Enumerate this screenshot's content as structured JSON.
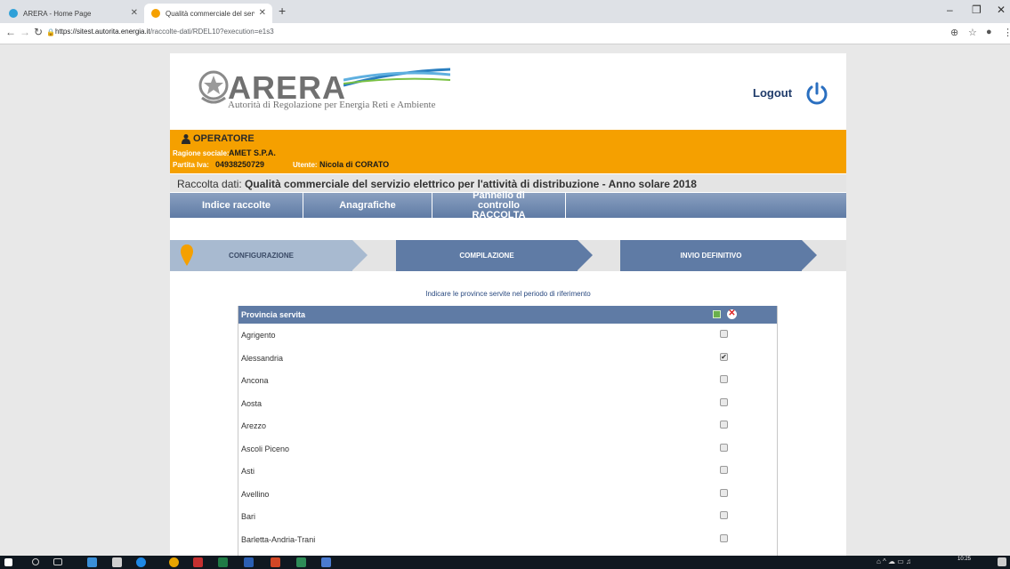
{
  "browser": {
    "tabs": [
      {
        "title": "ARERA - Home Page"
      },
      {
        "title": "Qualità commerciale del servizio"
      }
    ],
    "url_host": "https://sitest.autorita.energia.it",
    "url_path": "/raccolte-dati/RDEL10?execution=e1s3"
  },
  "header": {
    "brand": "ARERA",
    "tagline": "Autorità di Regolazione per Energia Reti e Ambiente",
    "logout_label": "Logout"
  },
  "operator": {
    "title": "OPERATORE",
    "ragione_sociale_label": "Ragione sociale:",
    "ragione_sociale": "AMET S.P.A.",
    "partita_iva_label": "Partita Iva:",
    "partita_iva": "04938250729",
    "utente_label": "Utente:",
    "utente": "Nicola di CORATO"
  },
  "raccolta": {
    "label": "Raccolta dati:",
    "title": "Qualità commerciale del servizio elettrico per l'attività di distribuzione - Anno solare 2018"
  },
  "nav": {
    "items": [
      {
        "label": "Indice raccolte"
      },
      {
        "label": "Anagrafiche"
      },
      {
        "label": "Pannello di controllo RACCOLTA"
      }
    ]
  },
  "steps": [
    {
      "label": "CONFIGURAZIONE"
    },
    {
      "label": "COMPILAZIONE"
    },
    {
      "label": "INVIO DEFINITIVO"
    }
  ],
  "instruction": "Indicare le province servite nel periodo di riferimento",
  "table": {
    "header": "Provincia servita",
    "rows": [
      {
        "name": "Agrigento",
        "checked": false
      },
      {
        "name": "Alessandria",
        "checked": true
      },
      {
        "name": "Ancona",
        "checked": false
      },
      {
        "name": "Aosta",
        "checked": false
      },
      {
        "name": "Arezzo",
        "checked": false
      },
      {
        "name": "Ascoli Piceno",
        "checked": false
      },
      {
        "name": "Asti",
        "checked": false
      },
      {
        "name": "Avellino",
        "checked": false
      },
      {
        "name": "Bari",
        "checked": false
      },
      {
        "name": "Barletta-Andria-Trani",
        "checked": false
      }
    ]
  },
  "taskbar": {
    "time": "10:25"
  },
  "colors": {
    "operator_bg": "#f5a000",
    "nav_bg": "#5f7ba5",
    "step_active": "#5f7ba5",
    "step_inactive": "#a8bad0"
  }
}
